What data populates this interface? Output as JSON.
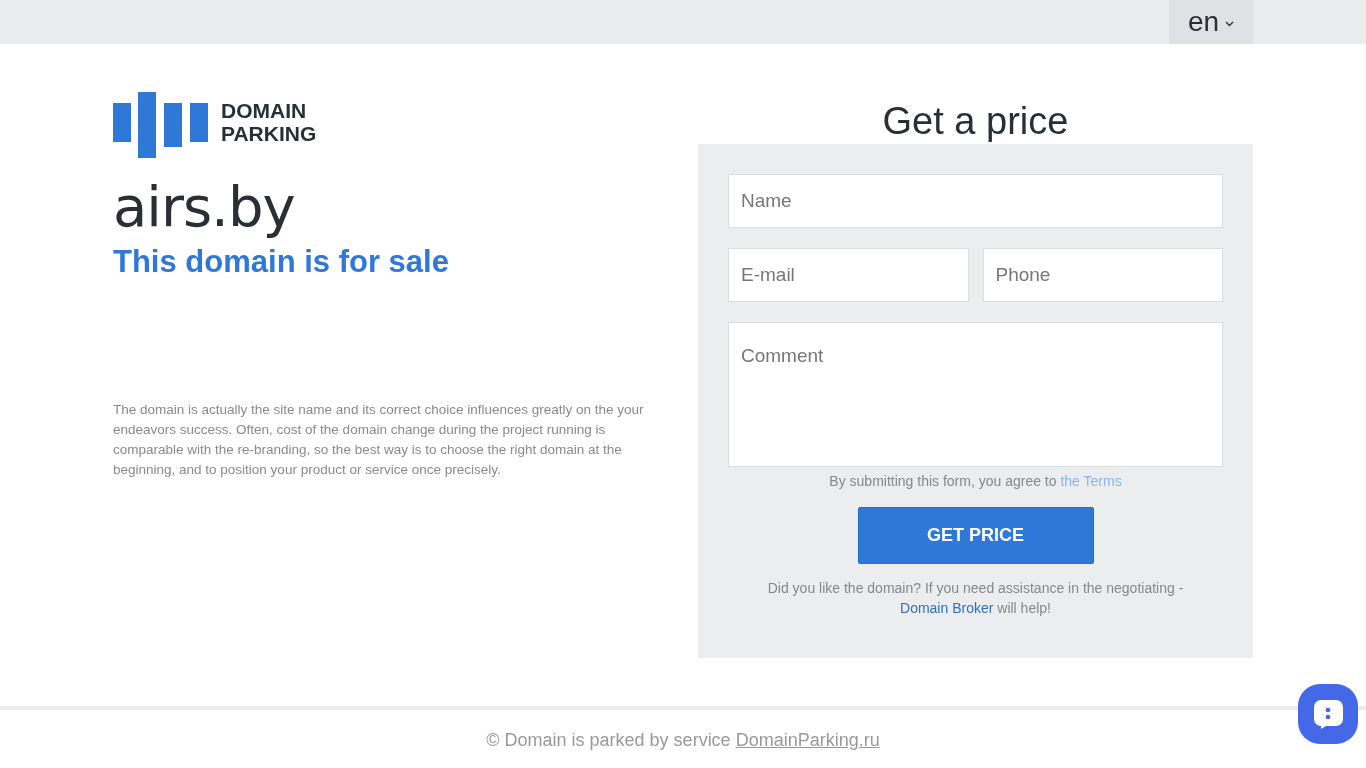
{
  "language": {
    "label": "en"
  },
  "logo": {
    "line1": "DOMAIN",
    "line2": "PARKING"
  },
  "domain": "airs.by",
  "tagline": "This domain is for sale",
  "description": "The domain is actually the site name and its correct choice influences greatly on the your endeavors success. Often, cost of the domain change during the project running is comparable with the re-branding, so the best way is to choose the right domain at the beginning, and to position your product or service once precisely.",
  "form": {
    "title": "Get a price",
    "fields": [
      {
        "placeholder": "Name"
      },
      {
        "placeholder": "E-mail"
      },
      {
        "placeholder": "Phone"
      },
      {
        "placeholder": "Comment"
      }
    ],
    "terms_text": "By submitting this form, you agree to",
    "terms_link": "the Terms",
    "button": "GET PRICE",
    "broker_text": "Did you like the domain? If you need assistance in the negotiating -",
    "broker_link": "Domain Broker",
    "broker_end": "will help!"
  },
  "footer": {
    "text": "© Domain is parked by service",
    "link": "DomainParking.ru"
  }
}
